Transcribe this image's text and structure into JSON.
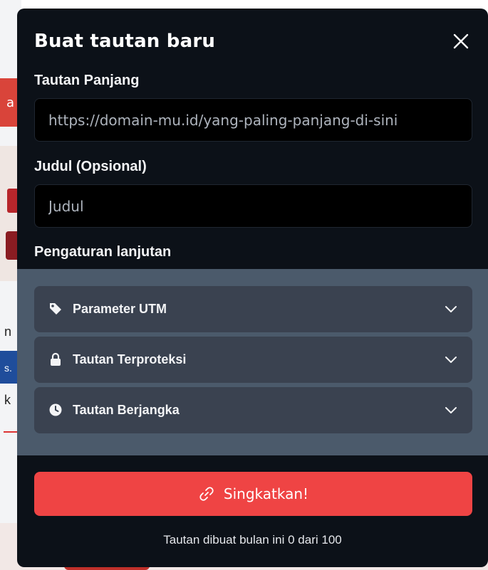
{
  "background": {
    "tab_letter": "a",
    "letter_1": "n",
    "blue_text": "s.",
    "letter_2": "k"
  },
  "modal": {
    "title": "Buat tautan baru",
    "close_icon": "close-icon",
    "long_url": {
      "label": "Tautan Panjang",
      "placeholder": "https://domain-mu.id/yang-paling-panjang-di-sini",
      "value": ""
    },
    "title_field": {
      "label": "Judul (Opsional)",
      "placeholder": "Judul",
      "value": ""
    },
    "advanced": {
      "label": "Pengaturan lanjutan",
      "items": [
        {
          "label": "Parameter UTM",
          "icon": "tag-icon"
        },
        {
          "label": "Tautan Terproteksi",
          "icon": "lock-icon"
        },
        {
          "label": "Tautan Berjangka",
          "icon": "clock-icon"
        }
      ]
    },
    "submit": {
      "label": "Singkatkan!",
      "icon": "link-icon"
    },
    "quota_text": "Tautan dibuat bulan ini 0 dari 100"
  },
  "colors": {
    "modal_bg": "#0c1118",
    "panel_bg": "#4b5a6b",
    "item_bg": "#3a4250",
    "accent": "#ef4444"
  }
}
